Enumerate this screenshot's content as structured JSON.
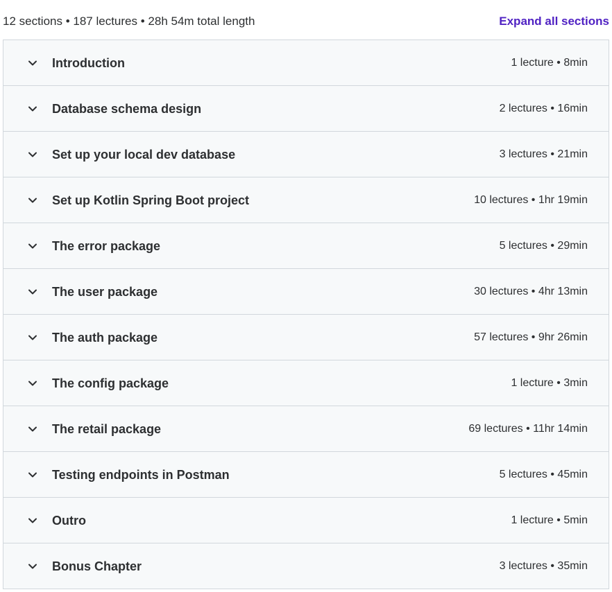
{
  "summary": {
    "text": "12 sections • 187 lectures • 28h 54m total length",
    "expand_label": "Expand all sections"
  },
  "icons": {
    "section_toggle": "chevron-down-icon"
  },
  "colors": {
    "accent": "#5022c3",
    "row_background": "#f7f9fa",
    "border": "#d1d7dc",
    "text": "#2d2f31"
  },
  "sections": [
    {
      "title": "Introduction",
      "meta": "1 lecture • 8min"
    },
    {
      "title": "Database schema design",
      "meta": "2 lectures • 16min"
    },
    {
      "title": "Set up your local dev database",
      "meta": "3 lectures • 21min"
    },
    {
      "title": "Set up Kotlin Spring Boot project",
      "meta": "10 lectures • 1hr 19min"
    },
    {
      "title": "The error package",
      "meta": "5 lectures • 29min"
    },
    {
      "title": "The user package",
      "meta": "30 lectures • 4hr 13min"
    },
    {
      "title": "The auth package",
      "meta": "57 lectures • 9hr 26min"
    },
    {
      "title": "The config package",
      "meta": "1 lecture • 3min"
    },
    {
      "title": "The retail package",
      "meta": "69 lectures • 11hr 14min"
    },
    {
      "title": "Testing endpoints in Postman",
      "meta": "5 lectures • 45min"
    },
    {
      "title": "Outro",
      "meta": "1 lecture • 5min"
    },
    {
      "title": "Bonus Chapter",
      "meta": "3 lectures • 35min"
    }
  ]
}
